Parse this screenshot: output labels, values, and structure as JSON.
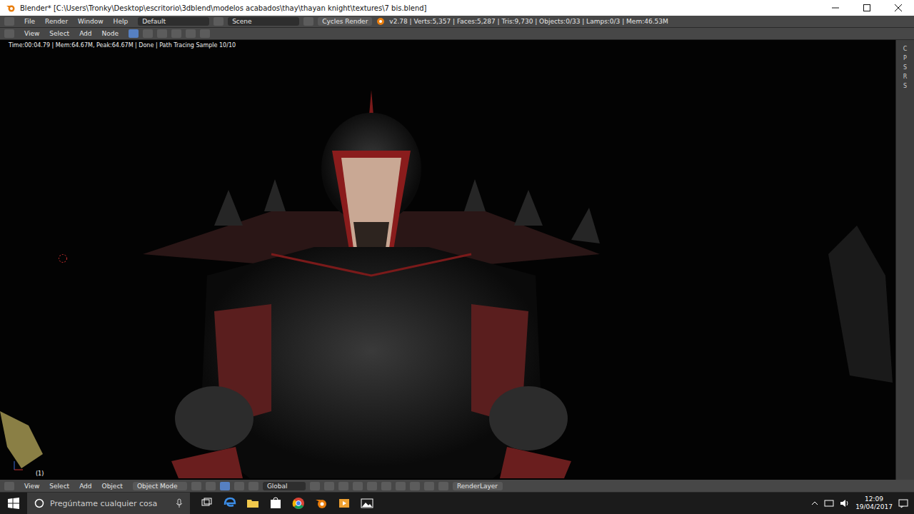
{
  "window": {
    "title": "Blender* [C:\\Users\\Tronky\\Desktop\\escritorio\\3dblend\\modelos acabados\\thay\\thayan knight\\textures\\7 bis.blend]"
  },
  "info_header": {
    "menus": [
      "File",
      "Render",
      "Window",
      "Help"
    ],
    "layout": "Default",
    "scene": "Scene",
    "engine": "Cycles Render",
    "stats": "v2.78 | Verts:5,357 | Faces:5,287 | Tris:9,730 | Objects:0/33 | Lamps:0/3 | Mem:46.53M"
  },
  "editor_header": {
    "menus": [
      "View",
      "Select",
      "Add",
      "Node"
    ]
  },
  "viewport": {
    "render_status": "Time:00:04.79 | Mem:64.67M, Peak:64.67M | Done | Path Tracing Sample 10/10",
    "frame": "(1)"
  },
  "side_tabs": [
    "C",
    "P",
    "S",
    "R",
    "S"
  ],
  "view3d_header": {
    "menus": [
      "View",
      "Select",
      "Add",
      "Object"
    ],
    "mode": "Object Mode",
    "orientation": "Global",
    "layer": "RenderLayer"
  },
  "taskbar": {
    "search_placeholder": "Pregúntame cualquier cosa",
    "time": "12:09",
    "date": "19/04/2017"
  }
}
